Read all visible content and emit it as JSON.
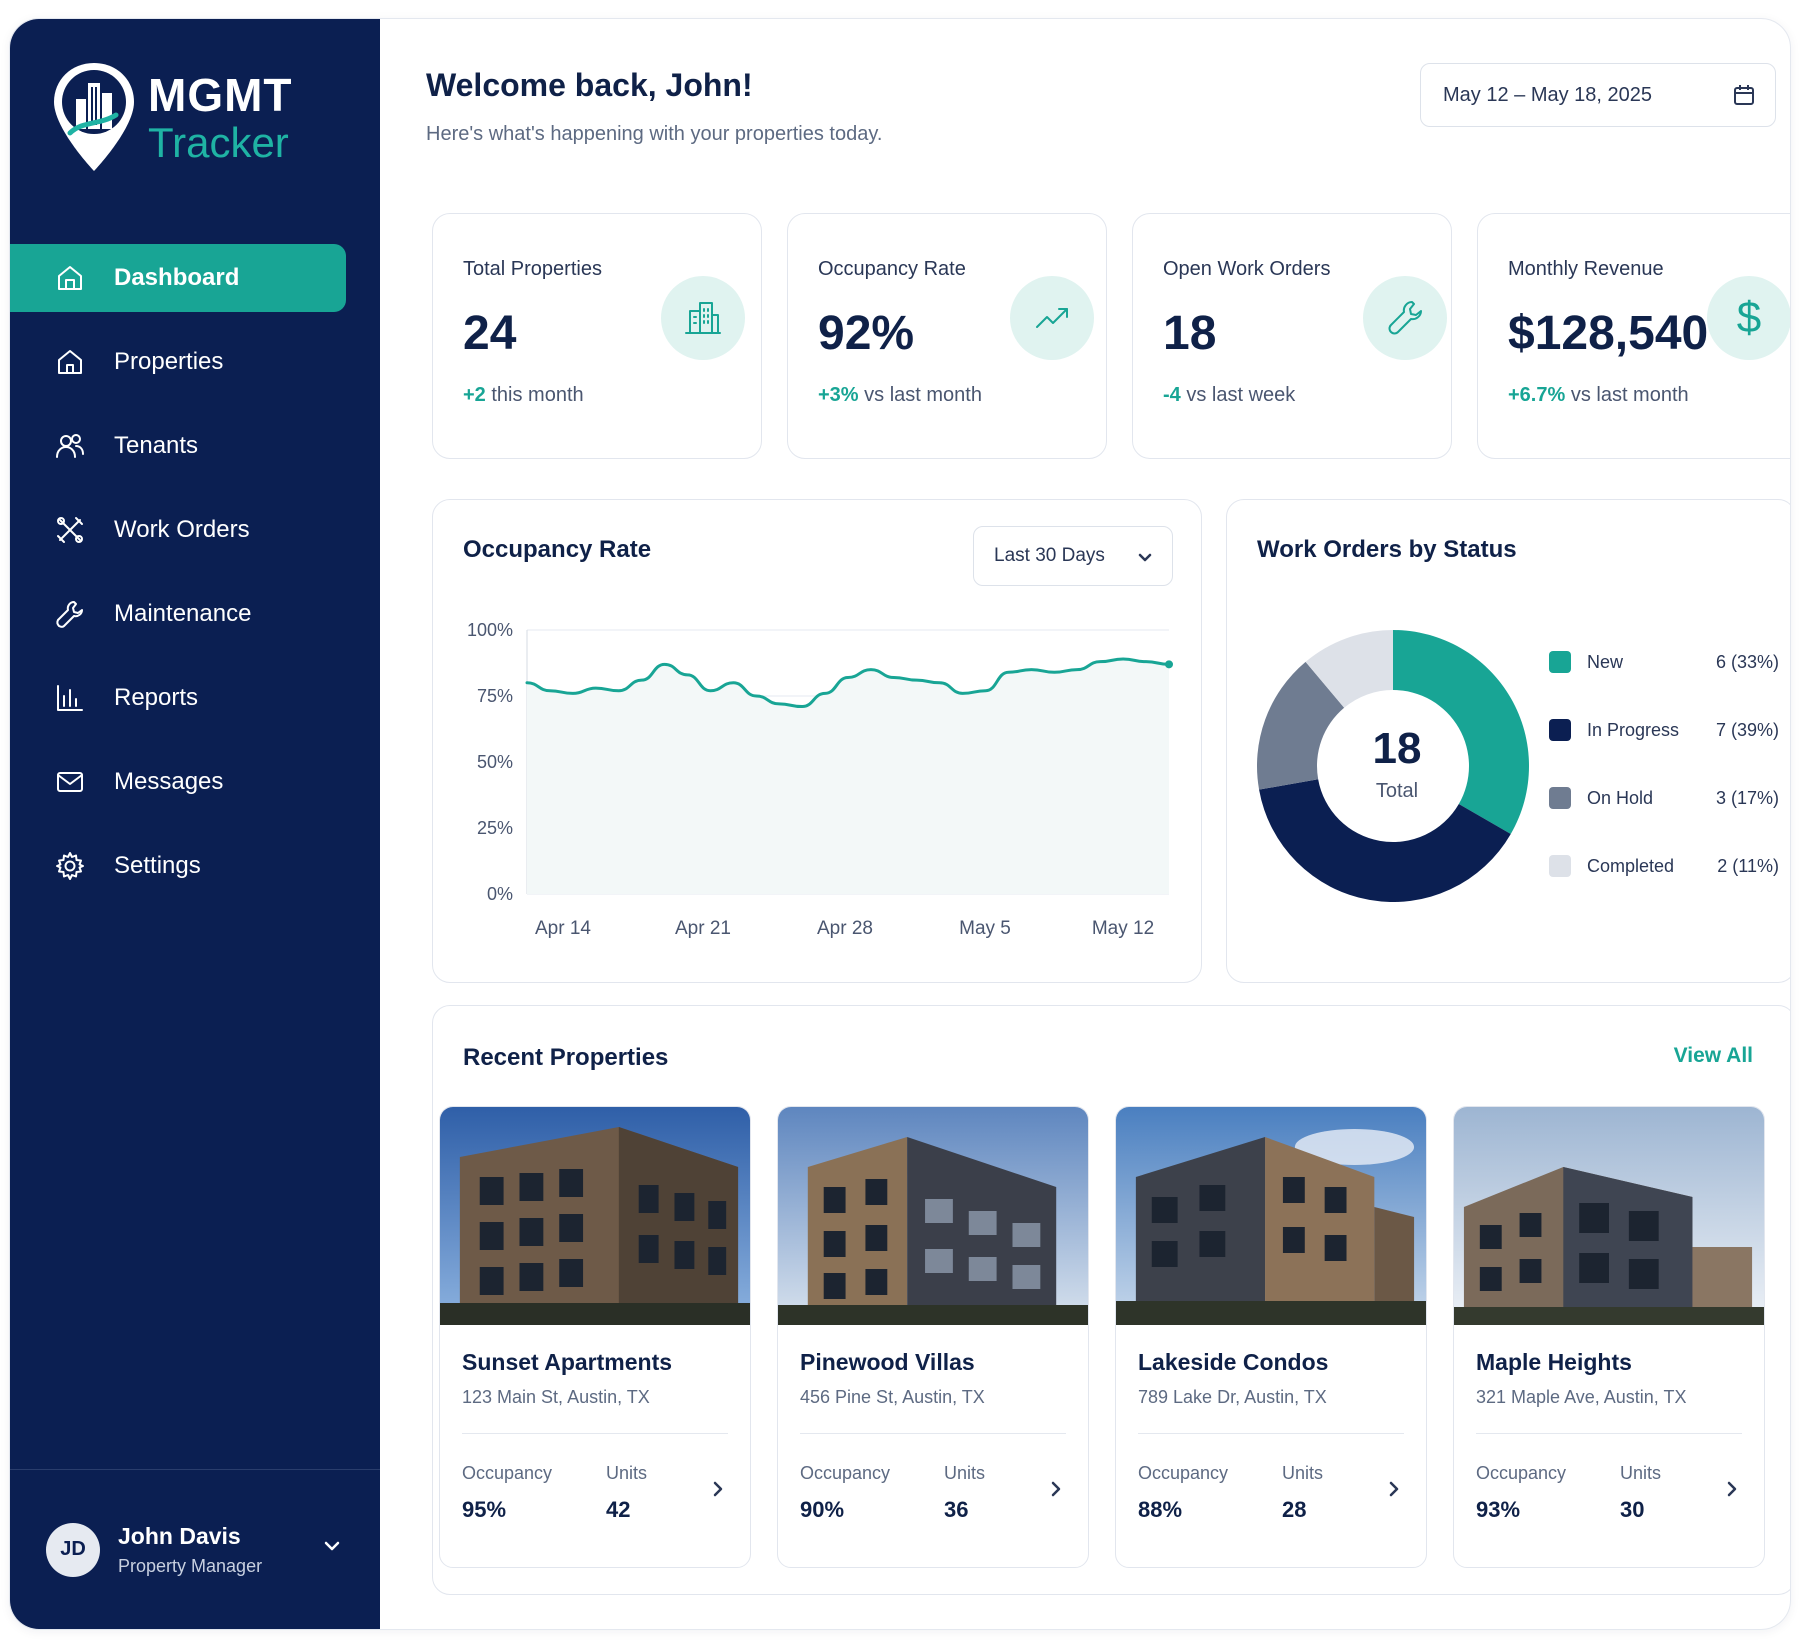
{
  "app": {
    "logo": {
      "line1": "MGMT",
      "line2": "Tracker"
    }
  },
  "sidebar": {
    "items": [
      {
        "label": "Dashboard",
        "icon": "home-icon",
        "active": true
      },
      {
        "label": "Properties",
        "icon": "house-icon"
      },
      {
        "label": "Tenants",
        "icon": "users-icon"
      },
      {
        "label": "Work Orders",
        "icon": "tools-icon"
      },
      {
        "label": "Maintenance",
        "icon": "wrench-icon"
      },
      {
        "label": "Reports",
        "icon": "bar-chart-icon"
      },
      {
        "label": "Messages",
        "icon": "mail-icon"
      },
      {
        "label": "Settings",
        "icon": "gear-icon"
      }
    ],
    "user": {
      "initials": "JD",
      "name": "John Davis",
      "role": "Property Manager"
    }
  },
  "header": {
    "welcome": "Welcome back, John!",
    "subtitle": "Here's what's happening with your properties today.",
    "date_range": "May 12 – May 18, 2025"
  },
  "kpis": [
    {
      "label": "Total Properties",
      "value": "24",
      "delta": "+2",
      "note": " this month",
      "icon": "building-icon"
    },
    {
      "label": "Occupancy Rate",
      "value": "92%",
      "delta": "+3%",
      "note": " vs last month",
      "icon": "trend-up-icon"
    },
    {
      "label": "Open Work Orders",
      "value": "18",
      "delta": "-4",
      "note": " vs last week",
      "icon": "wrench-icon"
    },
    {
      "label": "Monthly Revenue",
      "value": "$128,540",
      "delta": "+6.7%",
      "note": " vs last month",
      "icon": "dollar-icon"
    }
  ],
  "occupancy_chart": {
    "title": "Occupancy Rate",
    "range_label": "Last 30 Days"
  },
  "work_orders": {
    "title": "Work Orders by Status",
    "total": "18",
    "total_label": "Total"
  },
  "recent": {
    "title": "Recent Properties",
    "view_all": "View All",
    "occupancy_label": "Occupancy",
    "units_label": "Units",
    "items": [
      {
        "name": "Sunset Apartments",
        "address": "123 Main St, Austin, TX",
        "occupancy": "95%",
        "units": "42"
      },
      {
        "name": "Pinewood Villas",
        "address": "456 Pine St, Austin, TX",
        "occupancy": "90%",
        "units": "36"
      },
      {
        "name": "Lakeside Condos",
        "address": "789 Lake Dr, Austin, TX",
        "occupancy": "88%",
        "units": "28"
      },
      {
        "name": "Maple Heights",
        "address": "321 Maple Ave, Austin, TX",
        "occupancy": "93%",
        "units": "30"
      }
    ]
  },
  "colors": {
    "sidebar": "#0b1f52",
    "accent": "#18a595",
    "text": "#0f2148",
    "on_hold": "#6f7c91",
    "completed": "#dde1e8"
  },
  "chart_data": [
    {
      "type": "line",
      "title": "Occupancy Rate",
      "x_tick_labels": [
        "Apr 14",
        "Apr 21",
        "Apr 28",
        "May 5",
        "May 12"
      ],
      "y_tick_labels": [
        "100%",
        "75%",
        "50%",
        "25%",
        "0%"
      ],
      "ylim": [
        0,
        100
      ],
      "grid": true,
      "series": [
        {
          "values": [
            80,
            77,
            76,
            78,
            77,
            81,
            87,
            83,
            77,
            80,
            75,
            72,
            71,
            76,
            82,
            85,
            82,
            81,
            80,
            76,
            77,
            84,
            85,
            84,
            85,
            88,
            89,
            88,
            87
          ]
        }
      ]
    },
    {
      "type": "pie",
      "title": "Work Orders by Status",
      "center_label": "18",
      "legend_position": "right",
      "slices": [
        {
          "label": "New",
          "value": 6,
          "display": "6 (33%)",
          "color": "#18a595"
        },
        {
          "label": "In Progress",
          "value": 7,
          "display": "7 (39%)",
          "color": "#0b1f52"
        },
        {
          "label": "On Hold",
          "value": 3,
          "display": "3 (17%)",
          "color": "#6f7c91"
        },
        {
          "label": "Completed",
          "value": 2,
          "display": "2 (11%)",
          "color": "#dde1e8"
        }
      ]
    }
  ]
}
